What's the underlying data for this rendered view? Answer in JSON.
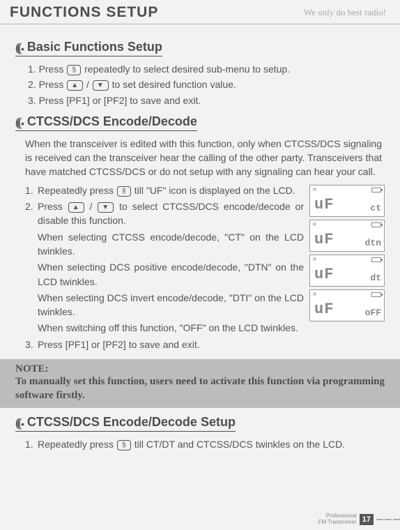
{
  "header": {
    "title": "FUNCTIONS SETUP",
    "slogan": "We only do best radio!"
  },
  "keys": {
    "sel": "§",
    "up": "▲",
    "down": "▼"
  },
  "sections": {
    "basic": {
      "title": "Basic Functions Setup",
      "s1a": "1. Press ",
      "s1b": " repeatedly to select desired sub-menu to setup.",
      "s2a": "2. Press ",
      "s2b": " / ",
      "s2c": " to set desired function value.",
      "s3": "3. Press [PF1] or [PF2] to save and exit."
    },
    "ctcss": {
      "title": "CTCSS/DCS Encode/Decode",
      "intro": "When the transceiver is edited with this function, only when CTCSS/DCS signaling is received can the transceiver hear the calling of the other party. Transceivers that have matched CTCSS/DCS or do not setup with any signaling can hear your call.",
      "i1n": "1.",
      "i1a": "Repeatedly press ",
      "i1b": " till \"UF\" icon is displayed on the LCD.",
      "i2n": "2.",
      "i2a": "Press ",
      "i2b": " / ",
      "i2c": " to select CTCSS/DCS encode/decode or disable this function.",
      "d1": "When selecting CTCSS encode/decode, \"CT\" on the LCD twinkles.",
      "d2": "When selecting DCS positive encode/decode, \"DTN\" on the LCD twinkles.",
      "d3": "When selecting DCS invert encode/decode, \"DTI\" on the LCD twinkles.",
      "d4": "When switching off this function, \"OFF\" on the LCD twinkles.",
      "i3n": "3.",
      "i3": "Press [PF1] or [PF2] to save and exit.",
      "lcd": [
        {
          "main": "uF",
          "side": "ct"
        },
        {
          "main": "uF",
          "side": "dtn"
        },
        {
          "main": "uF",
          "side": "dt"
        },
        {
          "main": "uF",
          "side": "oFF"
        }
      ]
    },
    "note": {
      "title": "NOTE:",
      "body": "To manually set this function, users need to activate this function via programming software firstly."
    },
    "setup": {
      "title": "CTCSS/DCS Encode/Decode Setup",
      "i1n": "1.",
      "i1a": "Repeatedly press ",
      "i1b": " till CT/DT and CTCSS/DCS twinkles on the LCD."
    }
  },
  "footer": {
    "line1": "Professional",
    "line2": "FM Transceiver",
    "page": "17"
  }
}
